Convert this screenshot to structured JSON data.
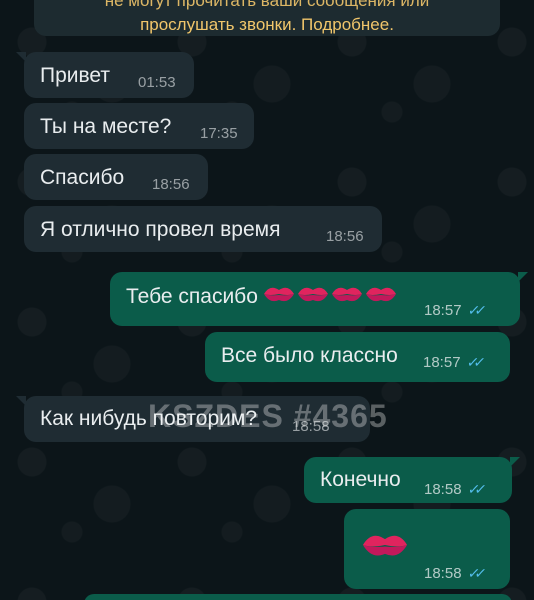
{
  "system_note": {
    "line1": "не могут прочитать ваши сообщения или",
    "line2": "прослушать звонки. Подробнее."
  },
  "messages": [
    {
      "text": "Привет",
      "time": "01:53",
      "direction": "in"
    },
    {
      "text": "Ты на месте?",
      "time": "17:35",
      "direction": "in"
    },
    {
      "text": "Спасибо",
      "time": "18:56",
      "direction": "in"
    },
    {
      "text": "Я отлично провел время",
      "time": "18:56",
      "direction": "in"
    },
    {
      "text": "Тебе спасибо",
      "emoji": "kiss-mark x4",
      "time": "18:57",
      "direction": "out",
      "status": "read"
    },
    {
      "text": "Все было классно",
      "time": "18:57",
      "direction": "out",
      "status": "read"
    },
    {
      "text": "Как нибудь повторим?",
      "time": "18:58",
      "direction": "in"
    },
    {
      "text": "Конечно",
      "time": "18:58",
      "direction": "out",
      "status": "read"
    },
    {
      "text": "",
      "emoji": "kiss-mark",
      "time": "18:58",
      "direction": "out",
      "status": "read"
    }
  ],
  "watermark": "KSZDES #4365",
  "colors": {
    "background": "#0c1519",
    "incoming_bubble": "#1f2c33",
    "outgoing_bubble": "#0b5c4a",
    "read_ticks": "#53bdeb",
    "note_text": "#f1c66b"
  }
}
